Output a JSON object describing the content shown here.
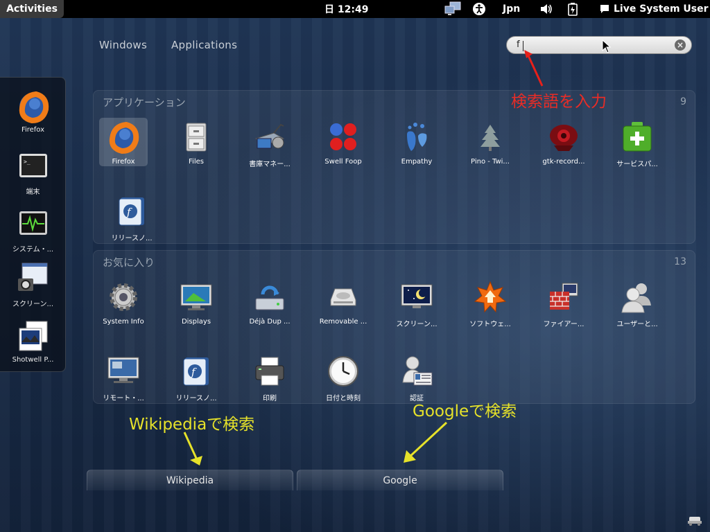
{
  "topbar": {
    "activities": "Activities",
    "clock": "日 12:49",
    "keyboard": "Jpn",
    "user": "Live System User"
  },
  "views": {
    "windows": "Windows",
    "applications": "Applications"
  },
  "search": {
    "value": "f"
  },
  "annotations": {
    "search_hint": "検索語を入力",
    "wikipedia_hint": "Wikipediaで検索",
    "google_hint": "Googleで検索"
  },
  "dash": [
    {
      "label": "Firefox",
      "icon": "firefox-icon"
    },
    {
      "label": "端末",
      "icon": "terminal-icon"
    },
    {
      "label": "システム・...",
      "icon": "system-monitor-icon"
    },
    {
      "label": "スクリーン...",
      "icon": "screenshot-icon"
    },
    {
      "label": "Shotwell P...",
      "icon": "shotwell-icon"
    }
  ],
  "applications": {
    "title": "アプリケーション",
    "count": "9",
    "items": [
      {
        "label": "Firefox",
        "icon": "firefox-icon"
      },
      {
        "label": "Files",
        "icon": "file-cabinet-icon"
      },
      {
        "label": "書庫マネー...",
        "icon": "archive-manager-icon"
      },
      {
        "label": "Swell Foop",
        "icon": "swell-foop-icon"
      },
      {
        "label": "Empathy",
        "icon": "empathy-icon"
      },
      {
        "label": "Pino - Twi...",
        "icon": "pino-tree-icon"
      },
      {
        "label": "gtk-record...",
        "icon": "gtk-recordmydesktop-icon"
      },
      {
        "label": "サービスパ...",
        "icon": "service-pack-icon"
      },
      {
        "label": "リリースノ...",
        "icon": "release-notes-icon"
      }
    ]
  },
  "favorites": {
    "title": "お気に入り",
    "count": "13",
    "items": [
      {
        "label": "System Info",
        "icon": "gear-icon"
      },
      {
        "label": "Displays",
        "icon": "display-icon"
      },
      {
        "label": "Déjà Dup ...",
        "icon": "deja-dup-icon"
      },
      {
        "label": "Removable ...",
        "icon": "removable-media-icon"
      },
      {
        "label": "スクリーン...",
        "icon": "screensaver-icon"
      },
      {
        "label": "ソフトウェ...",
        "icon": "software-update-icon"
      },
      {
        "label": "ファイアー...",
        "icon": "firewall-icon"
      },
      {
        "label": "ユーザーと...",
        "icon": "users-icon"
      },
      {
        "label": "リモート・...",
        "icon": "remote-desktop-icon"
      },
      {
        "label": "リリースノ...",
        "icon": "release-notes-icon"
      },
      {
        "label": "印刷",
        "icon": "printer-icon"
      },
      {
        "label": "日付と時刻",
        "icon": "clock-icon"
      },
      {
        "label": "認証",
        "icon": "authentication-icon"
      }
    ]
  },
  "providers": [
    {
      "label": "Wikipedia"
    },
    {
      "label": "Google"
    }
  ]
}
